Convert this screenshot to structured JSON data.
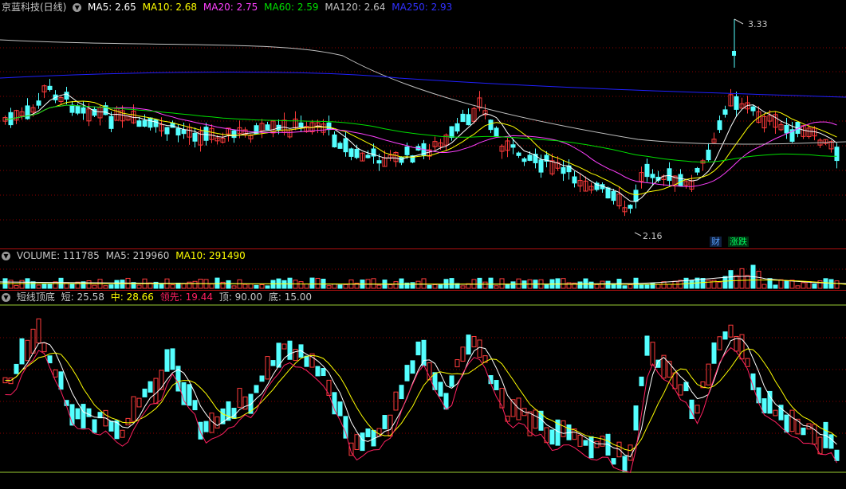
{
  "price_header": {
    "title": "京蓝科技(日线)",
    "ma5": "MA5: 2.65",
    "ma10": "MA10: 2.68",
    "ma20": "MA20: 2.75",
    "ma60": "MA60: 2.59",
    "ma120": "MA120: 2.64",
    "ma250": "MA250: 2.93"
  },
  "price_annotations": {
    "high": "3.33",
    "low": "2.16",
    "tag_cai": "财",
    "tag_zhangdie": "涨跌"
  },
  "volume_header": {
    "volume": "VOLUME: 111785",
    "ma5": "MA5: 219960",
    "ma10": "MA10: 291490"
  },
  "osc_header": {
    "name": "短线顶底",
    "short": "短: 25.58",
    "mid": "中: 28.66",
    "lead": "领先: 19.44",
    "top": "顶: 90.00",
    "bottom": "底: 15.00"
  },
  "colors": {
    "up": "#ff3b3b",
    "down": "#54ffff",
    "ma5": "#ffffff",
    "ma10": "#ffff00",
    "ma20": "#ff40ff",
    "ma60": "#00e000",
    "ma120": "#c0c0c0",
    "ma250": "#2020ff",
    "grid": "#8b0000",
    "osc_lead": "#ff2060",
    "osc_top_line": "#9acd32"
  },
  "chart_data": {
    "type": "candlestick",
    "y_range": [
      2.16,
      3.33
    ],
    "high_label": 3.33,
    "low_label": 2.16,
    "indicators": {
      "MA5": 2.65,
      "MA10": 2.68,
      "MA20": 2.75,
      "MA60": 2.59,
      "MA120": 2.64,
      "MA250": 2.93,
      "VOLUME": 111785,
      "VOL_MA5": 219960,
      "VOL_MA10": 291490,
      "short": 25.58,
      "mid": 28.66,
      "lead": 19.44,
      "top": 90.0,
      "bottom": 15.0
    }
  }
}
